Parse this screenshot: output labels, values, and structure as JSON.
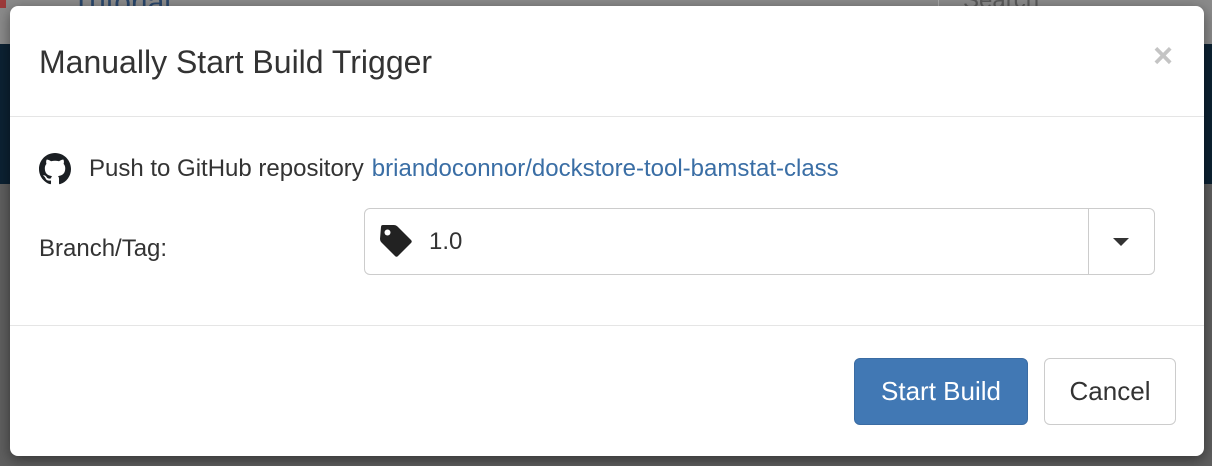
{
  "background": {
    "page_title": "Tutorial",
    "search_placeholder": "Search"
  },
  "modal": {
    "title": "Manually Start Build Trigger",
    "close_label": "×",
    "repo": {
      "prefix": "Push to GitHub repository",
      "link_text": "briandoconnor/dockstore-tool-bamstat-class"
    },
    "branch": {
      "label": "Branch/Tag:",
      "selected_value": "1.0"
    },
    "footer": {
      "start_build_label": "Start Build",
      "cancel_label": "Cancel"
    }
  },
  "colors": {
    "primary_button": "#4178b4",
    "link": "#3a6ea5",
    "nav_background": "#0c2233"
  },
  "icons": {
    "repo_icon": "github-icon",
    "branch_icon": "tag-icon",
    "dropdown_icon": "caret-down-icon"
  }
}
